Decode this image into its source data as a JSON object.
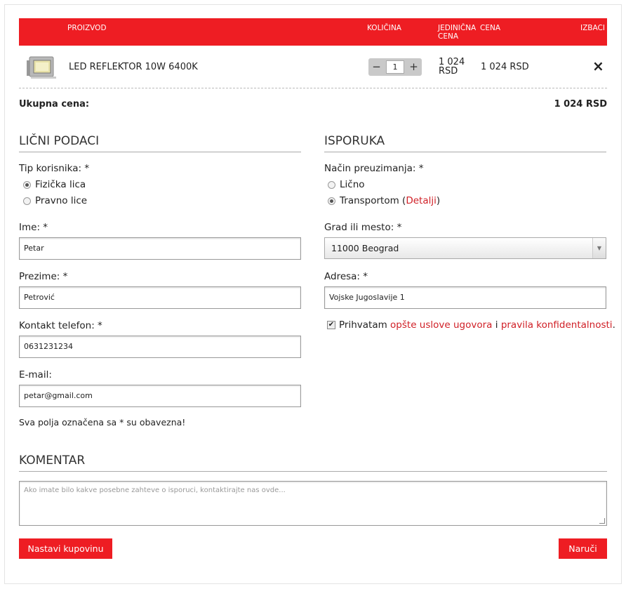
{
  "cart": {
    "headers": {
      "product": "PROIZVOD",
      "quantity": "KOLIČINA",
      "unit_price_1": "JEDINIČNA",
      "unit_price_2": "CENA",
      "price": "CENA",
      "remove": "IZBACI"
    },
    "item": {
      "name": "LED REFLEKTOR 10W 6400K",
      "quantity": "1",
      "minus": "−",
      "plus": "+",
      "unit_price_1": "1 024",
      "unit_price_2": "RSD",
      "price": "1 024 RSD",
      "remove_icon": "×"
    },
    "total_label": "Ukupna cena:",
    "total_value": "1 024 RSD"
  },
  "personal": {
    "title": "LIČNI PODACI",
    "user_type_label": "Tip korisnika: *",
    "user_types": [
      "Fizička lica",
      "Pravno lice"
    ],
    "user_type_selected": 0,
    "first_name_label": "Ime: *",
    "first_name_value": "Petar",
    "last_name_label": "Prezime: *",
    "last_name_value": "Petrović",
    "phone_label": "Kontakt telefon: *",
    "phone_value": "0631231234",
    "email_label": "E-mail:",
    "email_value": "petar@gmail.com",
    "required_note": "Sva polja označena sa * su obavezna!"
  },
  "delivery": {
    "title": "ISPORUKA",
    "method_label": "Način preuzimanja: *",
    "method_personal": "Lično",
    "method_transport": "Transportom (",
    "details_link": "Detalji",
    "close_paren": ")",
    "method_selected": "transport",
    "city_label": "Grad ili mesto: *",
    "city_value": "11000 Beograd",
    "address_label": "Adresa: *",
    "address_value": "Vojske Jugoslavije 1",
    "accept_prefix": "Prihvatam",
    "terms_link": "opšte uslove ugovora",
    "and": "i",
    "privacy_link": "pravila konfidentalnosti",
    "accept_suffix": ".",
    "accepted": true
  },
  "comment": {
    "title": "KOMENTAR",
    "placeholder": "Ako imate bilo kakve posebne zahteve o isporuci, kontaktirajte nas ovde..."
  },
  "actions": {
    "continue_label": "Nastavi kupovinu",
    "order_label": "Naruči"
  },
  "colors": {
    "accent": "#ee1d23",
    "link": "#d01f26"
  }
}
